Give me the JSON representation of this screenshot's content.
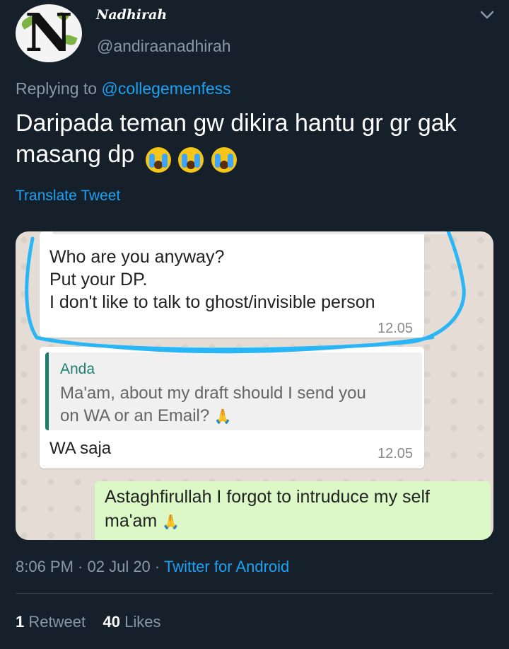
{
  "user": {
    "display_name": "Nadhirah",
    "handle": "@andiraanadhirah",
    "avatar_letter": "N"
  },
  "tweet": {
    "replying_prefix": "Replying to",
    "replying_to": "@collegemenfess",
    "text": "Daripada teman gw dikira hantu gr gr gak masang dp",
    "emoji": [
      "loudly-crying-face",
      "loudly-crying-face",
      "loudly-crying-face"
    ],
    "translate_label": "Translate Tweet",
    "time": "8:06 PM",
    "date": "02 Jul 20",
    "source": "Twitter for Android",
    "separator": " · "
  },
  "media": {
    "message1": {
      "lines": [
        "Who are you anyway?",
        "Put your DP.",
        "I don't like to talk to ghost/invisible person"
      ],
      "time": "12.05"
    },
    "message2": {
      "quote_author": "Anda",
      "quote_lines": [
        "Ma'am, about my draft should I send you",
        "on WA or an Email?"
      ],
      "reply": "WA saja",
      "time": "12.05"
    },
    "message3": {
      "lines": [
        "Astaghfirullah I forgot to intruduce my self",
        "ma'am"
      ]
    },
    "colors": {
      "chat_bg": "#e5ddd5",
      "incoming_bubble": "#ffffff",
      "outgoing_bubble": "#dcf8c6",
      "highlight_scribble": "#29b6f6",
      "quote_accent": "#1f7f6e"
    }
  },
  "stats": {
    "retweets_count": "1",
    "retweets_label": "Retweet",
    "likes_count": "40",
    "likes_label": "Likes"
  },
  "colors": {
    "background": "#15202b",
    "secondary_text": "#8899a6",
    "link": "#1da1f2"
  }
}
